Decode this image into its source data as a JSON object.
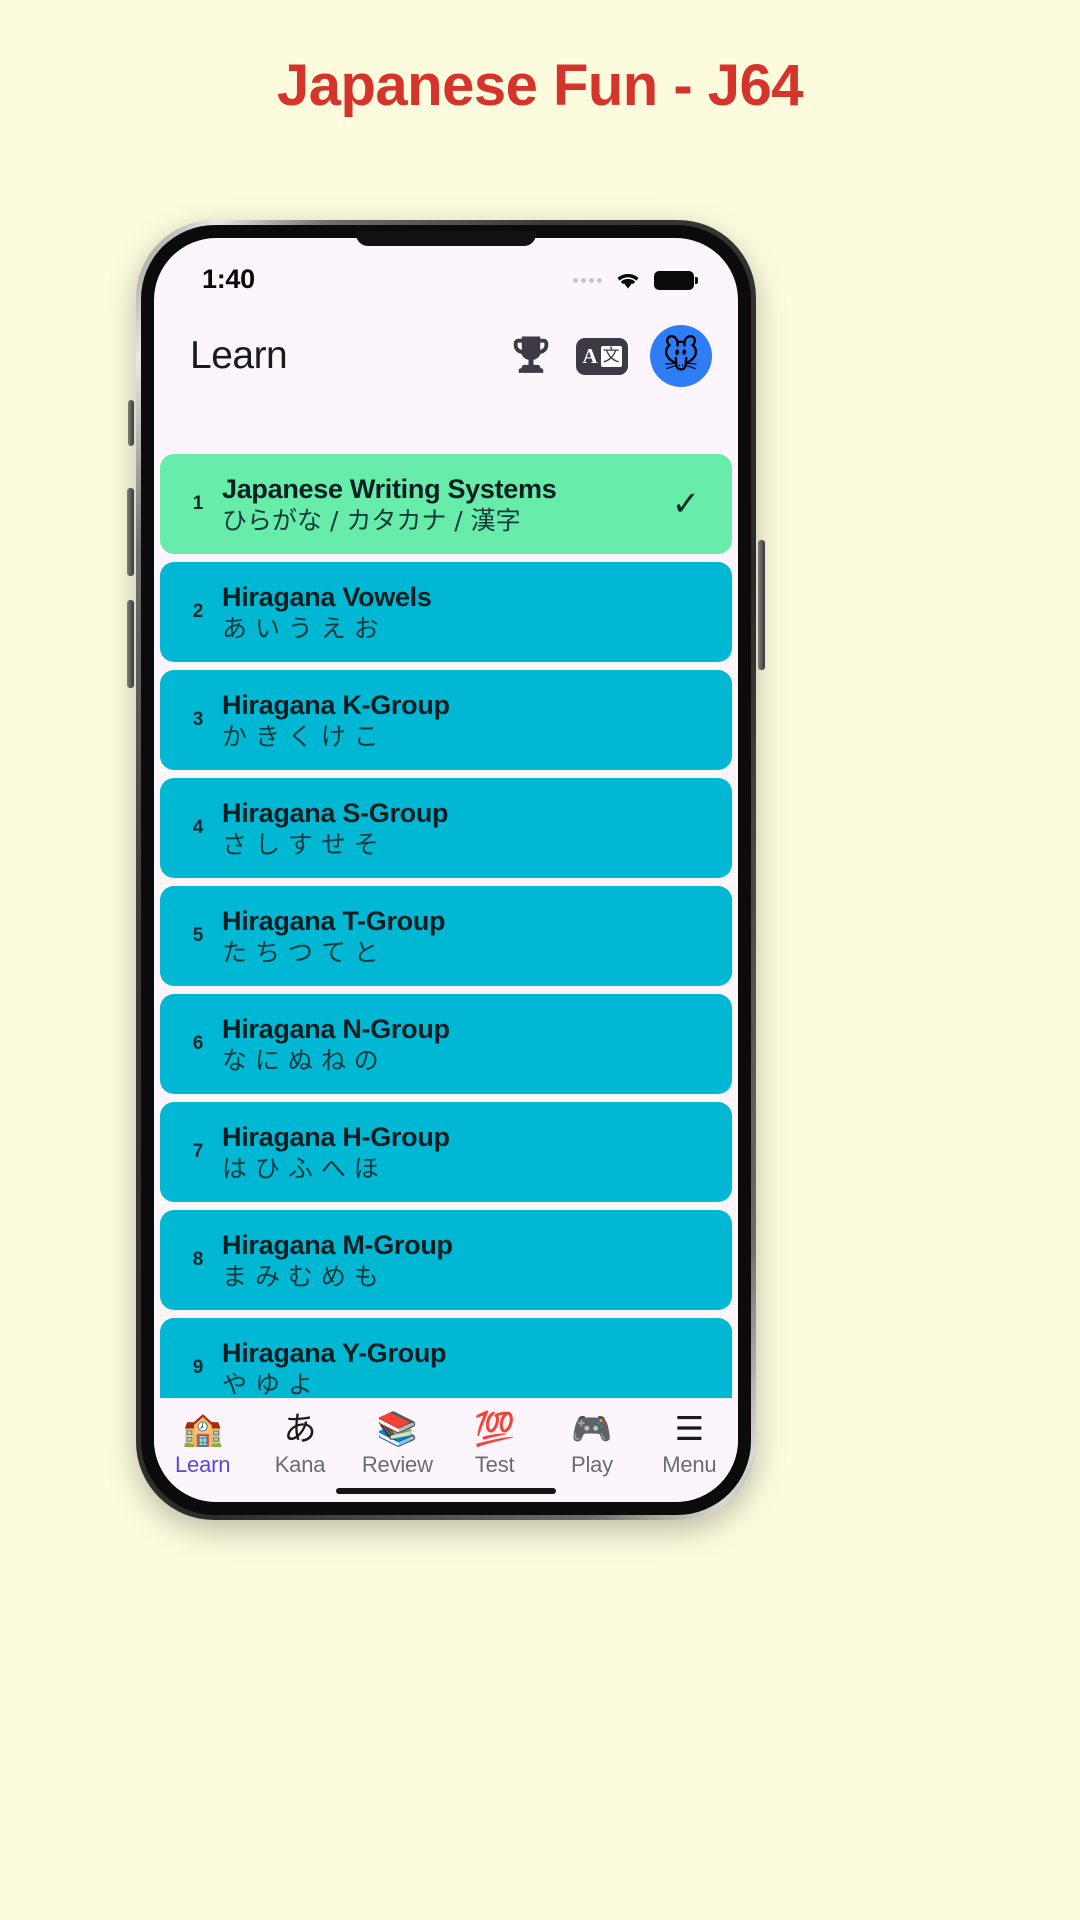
{
  "page": {
    "title": "Japanese Fun - J64",
    "background_color": "#fcfbdd",
    "title_color": "#d5342b"
  },
  "status_bar": {
    "time": "1:40",
    "signal_icon": "signal-dots-icon",
    "wifi_icon": "wifi-icon",
    "battery_icon": "battery-icon"
  },
  "header": {
    "title": "Learn",
    "trophy_icon": "trophy-icon",
    "translate_icon": "translate-icon",
    "translate_left_glyph": "A",
    "translate_right_glyph": "文",
    "avatar_icon": "mouse-avatar-icon",
    "avatar_emoji": "🐭",
    "avatar_color": "#2f7df6"
  },
  "lessons": {
    "completed_color": "#68ecaa",
    "default_color": "#00b8d4",
    "check_glyph": "✓",
    "items": [
      {
        "number": "1",
        "title": "Japanese Writing Systems",
        "subtitle": "ひらがな / カタカナ / 漢字",
        "completed": true
      },
      {
        "number": "2",
        "title": "Hiragana Vowels",
        "subtitle": "あ い う え お",
        "completed": false
      },
      {
        "number": "3",
        "title": "Hiragana K-Group",
        "subtitle": "か き く け こ",
        "completed": false
      },
      {
        "number": "4",
        "title": "Hiragana S-Group",
        "subtitle": "さ し す せ そ",
        "completed": false
      },
      {
        "number": "5",
        "title": "Hiragana T-Group",
        "subtitle": "た ち つ て と",
        "completed": false
      },
      {
        "number": "6",
        "title": "Hiragana N-Group",
        "subtitle": "な に ぬ ね の",
        "completed": false
      },
      {
        "number": "7",
        "title": "Hiragana H-Group",
        "subtitle": "は ひ ふ へ ほ",
        "completed": false
      },
      {
        "number": "8",
        "title": "Hiragana M-Group",
        "subtitle": "ま み む め も",
        "completed": false
      },
      {
        "number": "9",
        "title": "Hiragana Y-Group",
        "subtitle": "や ゆ よ",
        "completed": false
      }
    ]
  },
  "tabbar": {
    "active_color": "#5b49d6",
    "items": [
      {
        "label": "Learn",
        "icon": "school-icon",
        "emoji": "🏫",
        "active": true
      },
      {
        "label": "Kana",
        "icon": "kana-icon",
        "emoji": "あ",
        "active": false
      },
      {
        "label": "Review",
        "icon": "books-icon",
        "emoji": "📚",
        "active": false
      },
      {
        "label": "Test",
        "icon": "hundred-points-icon",
        "emoji": "💯",
        "active": false
      },
      {
        "label": "Play",
        "icon": "game-controller-icon",
        "emoji": "🎮",
        "active": false
      },
      {
        "label": "Menu",
        "icon": "hamburger-menu-icon",
        "emoji": "☰",
        "active": false
      }
    ]
  }
}
